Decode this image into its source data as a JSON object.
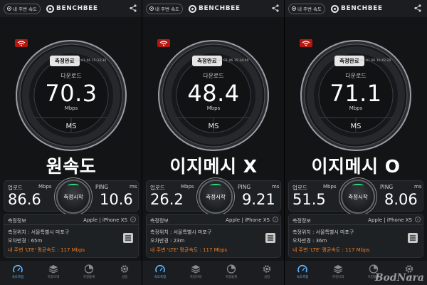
{
  "topbar": {
    "nearby_label": "내 주변 속도",
    "brand": "BENCHBEE"
  },
  "common": {
    "complete_label": "측정완료",
    "download_label": "다운로드",
    "mbps_unit": "Mbps",
    "ms_label": "MS",
    "upload_label": "업로드",
    "ping_label": "PING",
    "ping_unit": "ms",
    "start_label": "측정시작",
    "info_title": "측정정보",
    "device": "Apple  |  iPhone XS",
    "location": "측정위치 : 서울특별시 마포구",
    "nearby_avg": "내 주변 'LTE' 평균속도 : 117 Mbps"
  },
  "panels": [
    {
      "timestamp": "2021.01.06 15:33:36",
      "download": "70.3",
      "caption": "원속도",
      "upload": "86.6",
      "ping": "10.6",
      "error_radius": "오차반경 : 65m"
    },
    {
      "timestamp": "2021.01.06 15:34:40",
      "download": "48.4",
      "caption": "이지메시 X",
      "upload": "26.2",
      "ping": "9.21",
      "error_radius": "오차반경 : 23m"
    },
    {
      "timestamp": "2021.01.06 16:42:20",
      "download": "71.1",
      "caption": "이지메시 O",
      "upload": "51.5",
      "ping": "8.06",
      "error_radius": "오차반경 : 36m"
    }
  ],
  "nav": [
    "속도측정",
    "측정이력",
    "측정통계",
    "설정"
  ],
  "watermark": "BodNara",
  "colors": {
    "accent_green": "#2fd97a",
    "nearby_orange": "#f07b24",
    "wifi_red": "#b3170f",
    "active_blue": "#5fb7ff"
  },
  "icons": [
    "share-icon",
    "wifi-icon",
    "building-icon",
    "speed-icon",
    "history-icon",
    "stats-icon",
    "settings-icon"
  ]
}
